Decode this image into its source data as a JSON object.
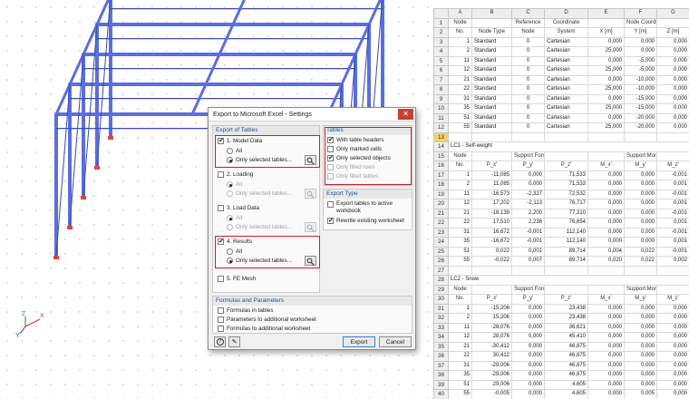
{
  "axes": {
    "x": "X",
    "y": "Y",
    "z": "Z"
  },
  "colors": {
    "member": "#5b6ee0",
    "member_dark": "#3a49b6",
    "support": "#e04545",
    "selection": "#c8202a",
    "dialog_title_text": "#1f4f99"
  },
  "dialog": {
    "title": "Export to Microsoft Excel - Settings",
    "close_icon": "close-icon",
    "export_tables": {
      "title": "Export of Tables",
      "items": [
        {
          "label": "1. Model Data",
          "checked": true,
          "all": "All",
          "selected": "Only selected tables...",
          "mode": "selected",
          "enabled": true
        },
        {
          "label": "2. Loading",
          "checked": false,
          "all": "All",
          "selected": "Only selected tables...",
          "mode": "all",
          "enabled": false
        },
        {
          "label": "3. Load Data",
          "checked": false,
          "all": "All",
          "selected": "Only selected tables...",
          "mode": "all",
          "enabled": false
        },
        {
          "label": "4. Results",
          "checked": true,
          "all": "All",
          "selected": "Only selected tables...",
          "mode": "selected",
          "enabled": true
        }
      ],
      "fe_mesh": "5. FE Mesh"
    },
    "tables": {
      "title": "Tables",
      "with_headers": "With table headers",
      "only_marked": "Only marked cells",
      "only_selected": "Only selected objects",
      "only_filled_rows": "Only filled rows",
      "only_filled_tables": "Only filled tables"
    },
    "export_type": {
      "title": "Export Type",
      "to_active_1": "Export tables to active",
      "to_active_2": "workbook",
      "rewrite": "Rewrite existing worksheet"
    },
    "formulas": {
      "title": "Formulas and Parameters",
      "in_tables": "Formulas in tables",
      "params": "Parameters to additional worksheet",
      "formulas_add": "Formulas to additional worksheet"
    },
    "buttons": {
      "export": "Export",
      "cancel": "Cancel"
    }
  },
  "sheet": {
    "columns": [
      "A",
      "B",
      "C",
      "D",
      "E",
      "F",
      "G"
    ],
    "rows": [
      {
        "n": "1",
        "cells": [
          "Node",
          "",
          "Reference",
          "Coordinate",
          "",
          "Node Coordinates",
          ""
        ],
        "kind": "hdr"
      },
      {
        "n": "2",
        "cells": [
          "No.",
          "Node Type",
          "Node",
          "System",
          "X [m]",
          "Y [m]",
          "Z [m]"
        ],
        "kind": "hdr"
      },
      {
        "n": "3",
        "cells": [
          "1",
          "Standard",
          "0",
          "Cartesian",
          "0,000",
          "0,000",
          "0,000"
        ],
        "kind": "node"
      },
      {
        "n": "4",
        "cells": [
          "2",
          "Standard",
          "0",
          "Cartesian",
          "25,000",
          "0,000",
          "0,000"
        ],
        "kind": "node"
      },
      {
        "n": "5",
        "cells": [
          "11",
          "Standard",
          "0",
          "Cartesian",
          "0,000",
          "-5,000",
          "0,000"
        ],
        "kind": "node"
      },
      {
        "n": "6",
        "cells": [
          "12",
          "Standard",
          "0",
          "Cartesian",
          "25,000",
          "-5,000",
          "0,000"
        ],
        "kind": "node"
      },
      {
        "n": "7",
        "cells": [
          "21",
          "Standard",
          "0",
          "Cartesian",
          "0,000",
          "-10,000",
          "0,000"
        ],
        "kind": "node"
      },
      {
        "n": "8",
        "cells": [
          "22",
          "Standard",
          "0",
          "Cartesian",
          "25,000",
          "-10,000",
          "0,000"
        ],
        "kind": "node"
      },
      {
        "n": "9",
        "cells": [
          "31",
          "Standard",
          "0",
          "Cartesian",
          "0,000",
          "-15,000",
          "0,000"
        ],
        "kind": "node"
      },
      {
        "n": "10",
        "cells": [
          "35",
          "Standard",
          "0",
          "Cartesian",
          "25,000",
          "-15,000",
          "0,000"
        ],
        "kind": "node"
      },
      {
        "n": "11",
        "cells": [
          "51",
          "Standard",
          "0",
          "Cartesian",
          "0,000",
          "-20,000",
          "0,000"
        ],
        "kind": "node"
      },
      {
        "n": "12",
        "cells": [
          "55",
          "Standard",
          "0",
          "Cartesian",
          "25,000",
          "-20,000",
          "0,000"
        ],
        "kind": "node"
      },
      {
        "n": "13",
        "cells": [
          "",
          "",
          "",
          "",
          "",
          "",
          ""
        ],
        "kind": "selrow"
      },
      {
        "n": "14",
        "cells": [
          "LC1 - Self-weight",
          "",
          "",
          "",
          "",
          "",
          ""
        ],
        "kind": "title"
      },
      {
        "n": "15",
        "cells": [
          "Node",
          "",
          "Support Forces [kN]",
          "",
          "",
          "Support Moments [kNm]",
          ""
        ],
        "kind": "hdr2"
      },
      {
        "n": "16",
        "cells": [
          "No.",
          "P_x'",
          "P_y'",
          "P_z'",
          "M_x'",
          "M_y'",
          "M_z'"
        ],
        "kind": "hdr"
      },
      {
        "n": "17",
        "cells": [
          "1",
          "-11,085",
          "0,000",
          "71,533",
          "0,000",
          "0,000",
          "-0,001"
        ],
        "kind": "res"
      },
      {
        "n": "18",
        "cells": [
          "2",
          "11,085",
          "0,000",
          "71,533",
          "0,000",
          "0,000",
          "0,001"
        ],
        "kind": "res"
      },
      {
        "n": "19",
        "cells": [
          "11",
          "-16,573",
          "-2,327",
          "72,532",
          "0,000",
          "0,000",
          "-0,001"
        ],
        "kind": "res"
      },
      {
        "n": "20",
        "cells": [
          "12",
          "17,202",
          "-2,113",
          "76,717",
          "0,000",
          "0,000",
          "0,001"
        ],
        "kind": "res"
      },
      {
        "n": "21",
        "cells": [
          "21",
          "-18,139",
          "2,200",
          "77,310",
          "0,000",
          "0,000",
          "-0,001"
        ],
        "kind": "res"
      },
      {
        "n": "22",
        "cells": [
          "22",
          "17,510",
          "2,236",
          "76,654",
          "0,000",
          "0,000",
          "0,001"
        ],
        "kind": "res"
      },
      {
        "n": "23",
        "cells": [
          "31",
          "16,672",
          "-0,001",
          "112,140",
          "0,000",
          "0,000",
          "-0,001"
        ],
        "kind": "res"
      },
      {
        "n": "24",
        "cells": [
          "35",
          "-16,672",
          "-0,001",
          "112,140",
          "0,000",
          "0,000",
          "0,001"
        ],
        "kind": "res"
      },
      {
        "n": "25",
        "cells": [
          "51",
          "0,022",
          "0,001",
          "89,714",
          "0,004",
          "0,022",
          "-0,001"
        ],
        "kind": "res"
      },
      {
        "n": "26",
        "cells": [
          "55",
          "-0,022",
          "0,007",
          "89,714",
          "0,020",
          "0,022",
          "0,002"
        ],
        "kind": "res"
      },
      {
        "n": "27",
        "cells": [
          "",
          "",
          "",
          "",
          "",
          "",
          ""
        ],
        "kind": "blank"
      },
      {
        "n": "28",
        "cells": [
          "LC2 - Snow",
          "",
          "",
          "",
          "",
          "",
          ""
        ],
        "kind": "title"
      },
      {
        "n": "29",
        "cells": [
          "Node",
          "",
          "Support Forces [kN]",
          "",
          "",
          "Support Moments [kNm]",
          ""
        ],
        "kind": "hdr2"
      },
      {
        "n": "30",
        "cells": [
          "No.",
          "P_x'",
          "P_y'",
          "P_z'",
          "M_x'",
          "M_y'",
          "M_z'"
        ],
        "kind": "hdr"
      },
      {
        "n": "31",
        "cells": [
          "1",
          "-15,206",
          "0,000",
          "23,438",
          "0,000",
          "0,000",
          "0,000"
        ],
        "kind": "res"
      },
      {
        "n": "32",
        "cells": [
          "2",
          "15,206",
          "0,000",
          "23,438",
          "0,000",
          "0,000",
          "0,000"
        ],
        "kind": "res"
      },
      {
        "n": "33",
        "cells": [
          "11",
          "-28,076",
          "0,000",
          "36,621",
          "0,000",
          "0,000",
          "0,000"
        ],
        "kind": "res"
      },
      {
        "n": "34",
        "cells": [
          "12",
          "28,076",
          "0,000",
          "45,410",
          "0,000",
          "0,000",
          "0,000"
        ],
        "kind": "res"
      },
      {
        "n": "35",
        "cells": [
          "21",
          "-30,412",
          "0,000",
          "46,875",
          "0,000",
          "0,000",
          "0,000"
        ],
        "kind": "res"
      },
      {
        "n": "36",
        "cells": [
          "22",
          "30,412",
          "0,000",
          "46,875",
          "0,000",
          "0,000",
          "0,000"
        ],
        "kind": "res"
      },
      {
        "n": "37",
        "cells": [
          "31",
          "-29,006",
          "0,000",
          "46,875",
          "0,000",
          "0,000",
          "0,000"
        ],
        "kind": "res"
      },
      {
        "n": "38",
        "cells": [
          "35",
          "-29,006",
          "0,000",
          "46,875",
          "0,000",
          "0,000",
          "0,000"
        ],
        "kind": "res"
      },
      {
        "n": "39",
        "cells": [
          "51",
          "29,006",
          "0,000",
          "4,605",
          "0,000",
          "0,000",
          "0,000"
        ],
        "kind": "res"
      },
      {
        "n": "40",
        "cells": [
          "55",
          "-0,005",
          "0,000",
          "4,605",
          "0,000",
          "0,005",
          "0,000"
        ],
        "kind": "res"
      }
    ]
  }
}
